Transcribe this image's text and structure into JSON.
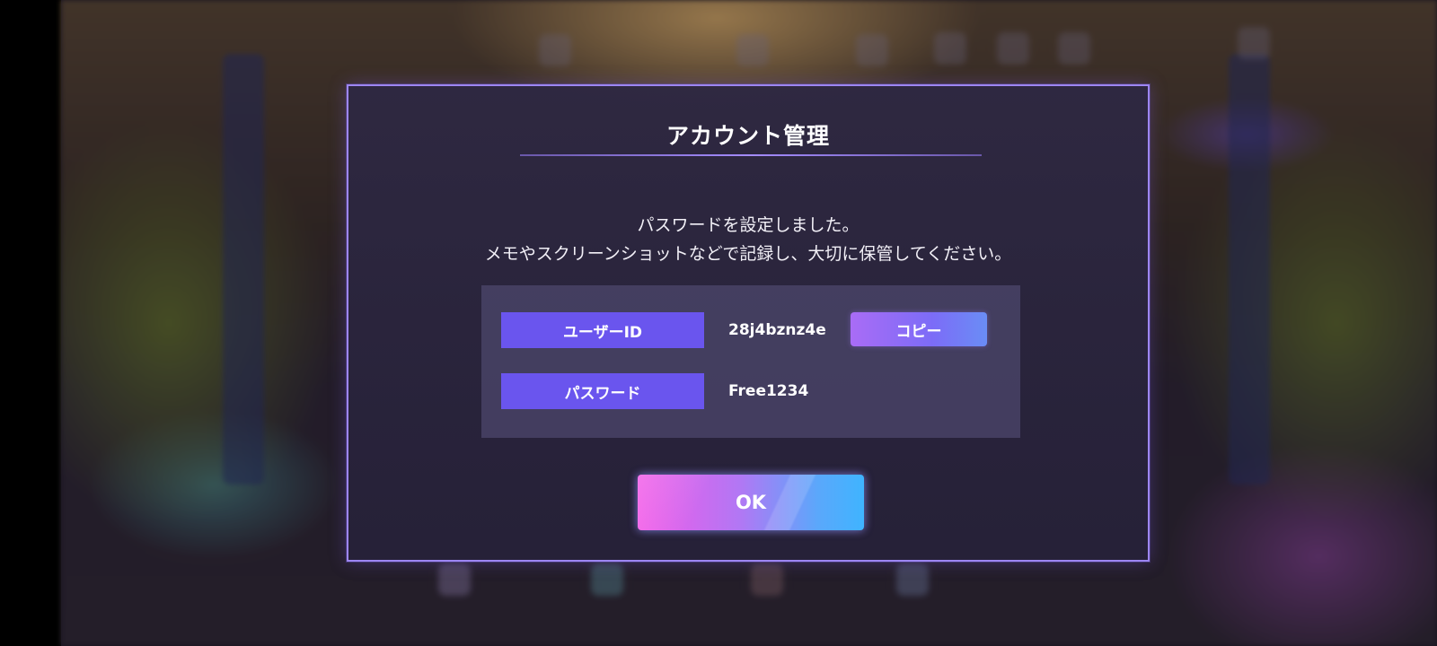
{
  "dialog": {
    "title": "アカウント管理",
    "message_line1": "パスワードを設定しました。",
    "message_line2": "メモやスクリーンショットなどで記録し、大切に保管してください。",
    "user_id_label": "ユーザーID",
    "user_id_value": "28j4bznz4e",
    "copy_label": "コピー",
    "password_label": "パスワード",
    "password_value": "Free1234",
    "ok_label": "OK"
  },
  "colors": {
    "dialog_border": "#9d86f3",
    "label_bg": "#6a55ee",
    "ok_gradient_start": "#f25ae8",
    "ok_gradient_end": "#3fb4ff"
  }
}
